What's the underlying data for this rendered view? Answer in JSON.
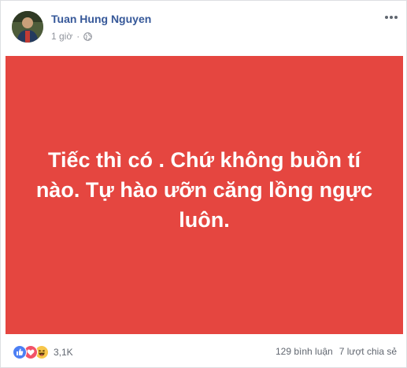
{
  "post": {
    "author": "Tuan Hung Nguyen",
    "time": "1 giờ",
    "separator": "·",
    "privacy_icon": "globe-icon",
    "menu_icon": "more-options-icon",
    "background_color": "#e54640",
    "text": "Tiếc thì có . Chứ không buồn tí nào. Tự hào ưỡn căng lồng ngực luôn."
  },
  "footer": {
    "reaction_icons": [
      "like-icon",
      "love-icon",
      "haha-icon"
    ],
    "reaction_count": "3,1K",
    "comments": "129 bình luận",
    "shares": "7 lượt chia sẻ"
  }
}
